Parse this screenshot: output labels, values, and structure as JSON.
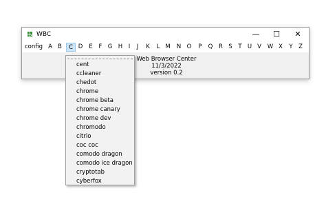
{
  "window": {
    "title": "WBC",
    "controls": {
      "minimize": "—",
      "maximize": "☐",
      "close": "✕"
    }
  },
  "menubar": {
    "config": "config",
    "letters": [
      "A",
      "B",
      "C",
      "D",
      "E",
      "F",
      "G",
      "H",
      "I",
      "J",
      "K",
      "L",
      "M",
      "N",
      "O",
      "P",
      "Q",
      "R",
      "S",
      "T",
      "U",
      "V",
      "W",
      "X",
      "Y",
      "Z"
    ],
    "active": "C"
  },
  "main": {
    "app_name": "Web Browser Center",
    "date": "11/3/2022",
    "version": "version 0.2"
  },
  "dropdown": {
    "items": [
      "cent",
      "ccleaner",
      "chedot",
      "chrome",
      "chrome beta",
      "chrome canary",
      "chrome dev",
      "chromodo",
      "citrio",
      "coc coc",
      "comodo dragon",
      "comodo ice dragon",
      "cryptotab",
      "cyberfox"
    ]
  }
}
